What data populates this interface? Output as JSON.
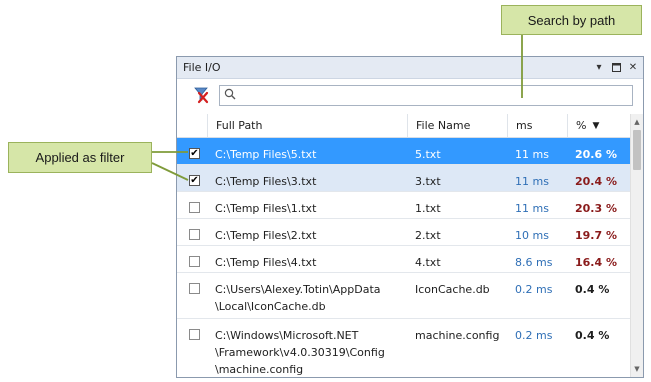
{
  "callouts": {
    "search": "Search by path",
    "filter": "Applied as filter"
  },
  "window": {
    "title": "File I/O",
    "buttons": [
      "dropdown-icon",
      "maximize-icon",
      "close-icon"
    ]
  },
  "toolbar": {
    "clear_filter_icon": "clear-filter-icon",
    "search_value": "",
    "search_placeholder": ""
  },
  "table": {
    "columns": [
      "",
      "Full Path",
      "File Name",
      "ms",
      "%"
    ],
    "sort_column": "%",
    "sort_direction": "descending",
    "rows": [
      {
        "checked": true,
        "path": "C:\\Temp Files\\5.txt",
        "name": "5.txt",
        "ms": "11 ms",
        "pct": "20.6 %",
        "state": "selected"
      },
      {
        "checked": true,
        "path": "C:\\Temp Files\\3.txt",
        "name": "3.txt",
        "ms": "11 ms",
        "pct": "20.4 %",
        "state": "highlighted"
      },
      {
        "checked": false,
        "path": "C:\\Temp Files\\1.txt",
        "name": "1.txt",
        "ms": "11 ms",
        "pct": "20.3 %",
        "state": ""
      },
      {
        "checked": false,
        "path": "C:\\Temp Files\\2.txt",
        "name": "2.txt",
        "ms": "10 ms",
        "pct": "19.7 %",
        "state": ""
      },
      {
        "checked": false,
        "path": "C:\\Temp Files\\4.txt",
        "name": "4.txt",
        "ms": "8.6 ms",
        "pct": "16.4 %",
        "state": ""
      },
      {
        "checked": false,
        "path": "C:\\Users\\Alexey.Totin\\AppData\n\\Local\\IconCache.db",
        "name": "IconCache.db",
        "ms": "0.2 ms",
        "pct": "0.4 %",
        "state": ""
      },
      {
        "checked": false,
        "path": "C:\\Windows\\Microsoft.NET\n\\Framework\\v4.0.30319\\Config\n\\machine.config",
        "name": "machine.config",
        "ms": "0.2 ms",
        "pct": "0.4 %",
        "state": ""
      }
    ]
  },
  "colors": {
    "selected_row": "#3399ff",
    "highlight_row": "#dde8f6",
    "ms_text": "#2f6fb6",
    "pct_hot": "#8a1b1b",
    "callout_bg": "#d6e6a8"
  }
}
